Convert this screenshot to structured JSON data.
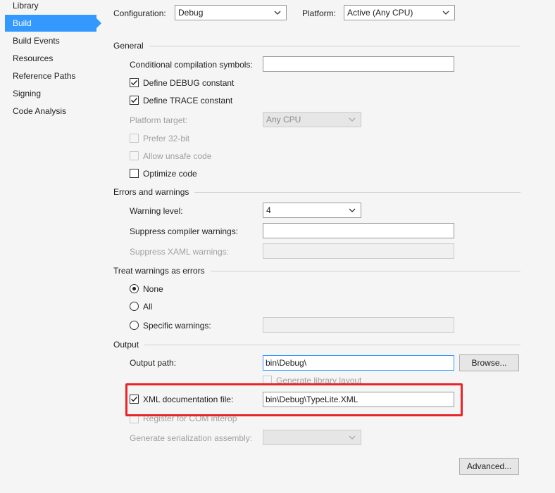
{
  "sidebar": {
    "items": [
      {
        "label": "Library"
      },
      {
        "label": "Build"
      },
      {
        "label": "Build Events"
      },
      {
        "label": "Resources"
      },
      {
        "label": "Reference Paths"
      },
      {
        "label": "Signing"
      },
      {
        "label": "Code Analysis"
      }
    ],
    "selected_color": "#3399ff"
  },
  "header": {
    "configuration_label": "Configuration:",
    "configuration_value": "Debug",
    "platform_label": "Platform:",
    "platform_value": "Active (Any CPU)"
  },
  "general": {
    "title": "General",
    "conditional_symbols_label": "Conditional compilation symbols:",
    "conditional_symbols_value": "",
    "define_debug_label": "Define DEBUG constant",
    "define_debug_checked": true,
    "define_trace_label": "Define TRACE constant",
    "define_trace_checked": true,
    "platform_target_label": "Platform target:",
    "platform_target_value": "Any CPU",
    "prefer32_label": "Prefer 32-bit",
    "unsafe_label": "Allow unsafe code",
    "optimize_label": "Optimize code",
    "optimize_checked": false
  },
  "errors": {
    "title": "Errors and warnings",
    "warning_level_label": "Warning level:",
    "warning_level_value": "4",
    "suppress_compiler_label": "Suppress compiler warnings:",
    "suppress_compiler_value": "",
    "suppress_xaml_label": "Suppress XAML warnings:"
  },
  "treat": {
    "title": "Treat warnings as errors",
    "options": [
      {
        "label": "None",
        "selected": true
      },
      {
        "label": "All",
        "selected": false
      },
      {
        "label": "Specific warnings:",
        "selected": false
      }
    ]
  },
  "output": {
    "title": "Output",
    "output_path_label": "Output path:",
    "output_path_value": "bin\\Debug\\",
    "browse_label": "Browse...",
    "generate_library_layout_label": "Generate library layout",
    "xml_doc_label": "XML documentation file:",
    "xml_doc_checked": true,
    "xml_doc_value": "bin\\Debug\\TypeLite.XML",
    "register_com_label": "Register for COM interop",
    "serialization_label": "Generate serialization assembly:",
    "advanced_label": "Advanced...",
    "highlight_color": "#e8262a"
  },
  "icons": {
    "combo_chevron": "chevron-down-icon",
    "checkmark": "checkmark-icon"
  }
}
